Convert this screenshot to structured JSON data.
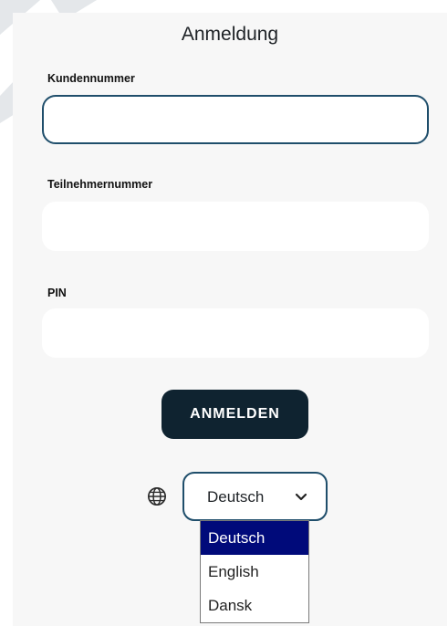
{
  "form": {
    "title": "Anmeldung",
    "fields": [
      {
        "label": "Kundennummer",
        "value": "",
        "placeholder": "",
        "focused": true
      },
      {
        "label": "Teilnehmernummer",
        "value": "",
        "placeholder": ""
      },
      {
        "label": "PIN",
        "value": "",
        "placeholder": ""
      }
    ],
    "submit_label": "ANMELDEN"
  },
  "language": {
    "icon": "globe-icon",
    "selected": "Deutsch",
    "dropdown_open": true,
    "options": [
      "Deutsch",
      "English",
      "Dansk"
    ]
  },
  "colors": {
    "panel_background": "#f7f7f7",
    "focus_border": "#1f4e6b",
    "button_background": "#0f2330",
    "option_highlight": "#000a7a"
  }
}
